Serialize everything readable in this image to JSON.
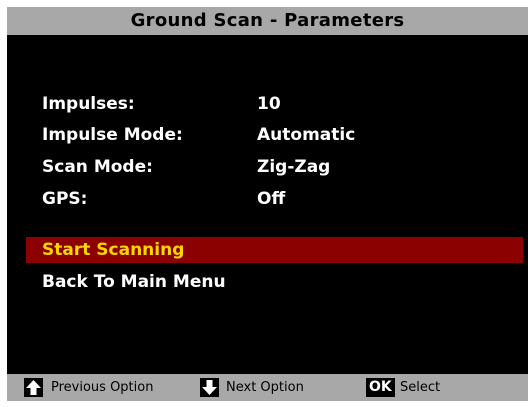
{
  "header": {
    "title": "Ground Scan - Parameters"
  },
  "parameters": [
    {
      "label": "Impulses:",
      "value": "10"
    },
    {
      "label": "Impulse Mode:",
      "value": "Automatic"
    },
    {
      "label": "Scan Mode:",
      "value": "Zig-Zag"
    },
    {
      "label": "GPS:",
      "value": "Off"
    }
  ],
  "menu": {
    "items": [
      {
        "label": "Start Scanning",
        "selected": true
      },
      {
        "label": "Back To Main Menu",
        "selected": false
      }
    ]
  },
  "footer": {
    "prev_icon": "arrow-up-key-icon",
    "prev_label": "Previous Option",
    "next_icon": "arrow-down-key-icon",
    "next_label": "Next Option",
    "ok_key": "OK",
    "ok_label": "Select"
  },
  "colors": {
    "bar_background": "#a8a8a8",
    "screen_background": "#000000",
    "highlight_background": "#8b0000",
    "highlight_text": "#ffd700",
    "text": "#ffffff"
  }
}
